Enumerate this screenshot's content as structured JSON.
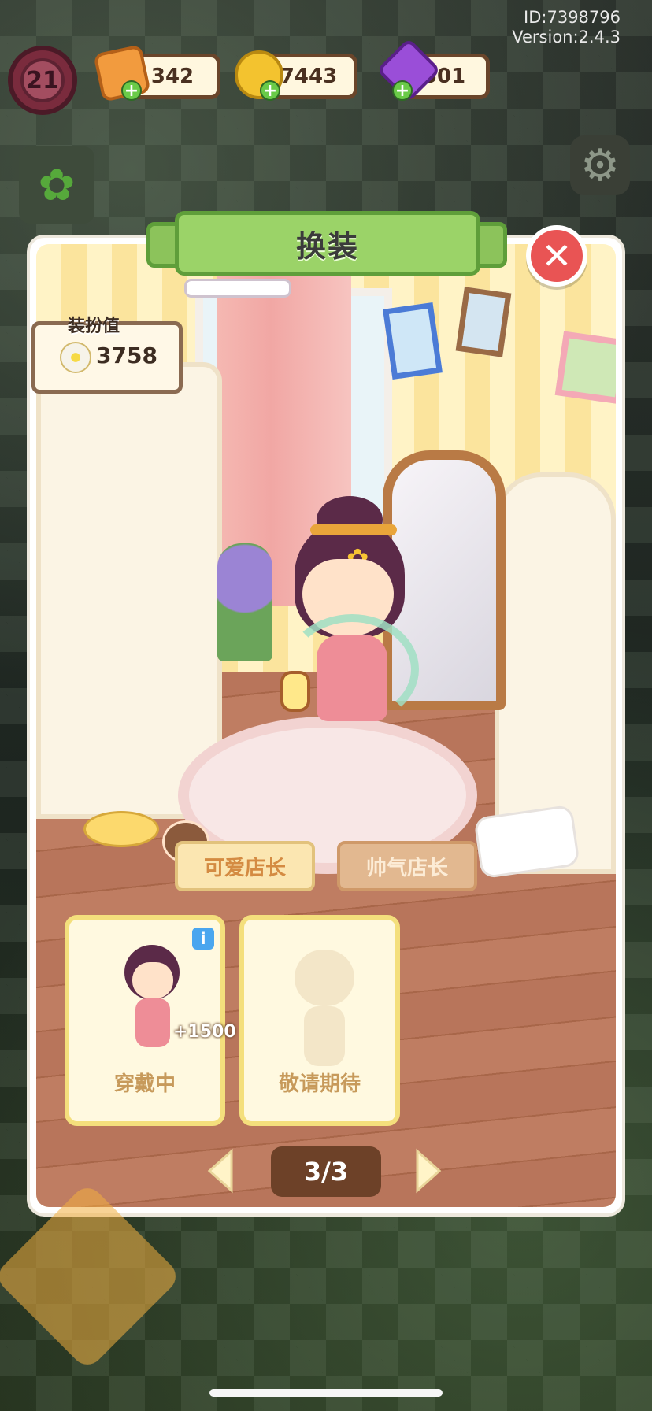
{
  "header": {
    "id_text": "ID:7398796",
    "version_text": "Version:2.4.3"
  },
  "player": {
    "level": "21"
  },
  "resources": [
    {
      "name": "ticket",
      "value": "342",
      "icon": "ticket-icon",
      "color": "#f29b3e"
    },
    {
      "name": "coin",
      "value": "7443",
      "icon": "coin-icon",
      "color": "#f3c32f"
    },
    {
      "name": "gem",
      "value": "501",
      "icon": "gem-icon",
      "color": "#9a4ed8"
    }
  ],
  "dialog": {
    "title": "换装",
    "close_icon": "close-icon",
    "dress_value": {
      "label": "装扮值",
      "value": "3758"
    },
    "tabs": [
      {
        "label": "可爱店长"
      },
      {
        "label": "帅气店长"
      }
    ],
    "cards": [
      {
        "label": "穿戴中",
        "bonus": "+1500"
      },
      {
        "label": "敬请期待"
      }
    ],
    "pager": {
      "text": "3/3"
    }
  },
  "colors": {
    "banner_green": "#9bd368",
    "close_red": "#e95454",
    "pager_brown": "#6d4128",
    "card_border": "#f4df7c"
  }
}
